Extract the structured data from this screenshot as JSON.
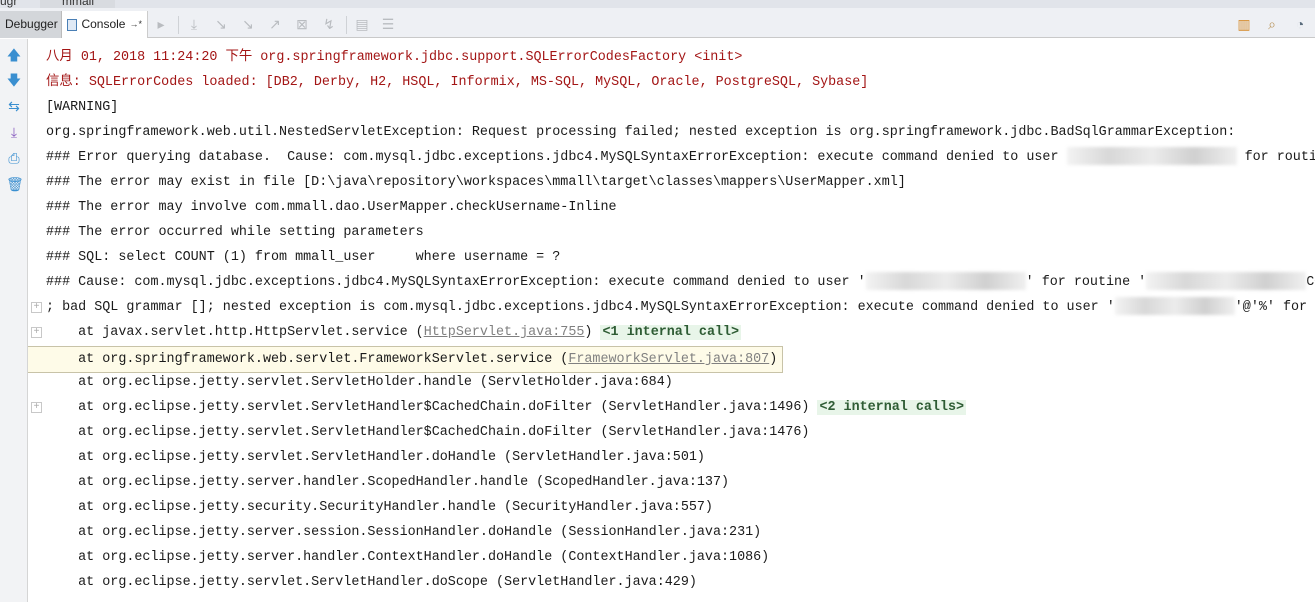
{
  "top_tabs": [
    "ugr",
    "mmall"
  ],
  "toolbar": {
    "debugger_tab": "Debugger",
    "console_tab": "Console",
    "console_suffix": "→*"
  },
  "console": {
    "lines": [
      {
        "cls": "red",
        "segs": [
          {
            "t": "八月 01, 2018 11:24:20 下午 org.springframework.jdbc.support.SQLErrorCodesFactory <init>"
          }
        ]
      },
      {
        "cls": "red",
        "segs": [
          {
            "t": "信息: SQLErrorCodes loaded: [DB2, Derby, H2, HSQL, Informix, MS-SQL, MySQL, Oracle, PostgreSQL, Sybase]"
          }
        ]
      },
      {
        "segs": [
          {
            "t": "[WARNING]"
          }
        ]
      },
      {
        "segs": [
          {
            "t": "org.springframework.web.util.NestedServletException: Request processing failed; nested exception is org.springframework.jdbc.BadSqlGrammarException:"
          }
        ]
      },
      {
        "segs": [
          {
            "t": "### Error querying database.  Cause: com.mysql.jdbc.exceptions.jdbc4.MySQLSyntaxErrorException: execute command denied to user "
          },
          {
            "blur": 170
          },
          {
            "t": " for routine"
          }
        ]
      },
      {
        "segs": [
          {
            "t": "### The error may exist in file [D:\\java\\repository\\workspaces\\mmall\\target\\classes\\mappers\\UserMapper.xml]"
          }
        ]
      },
      {
        "segs": [
          {
            "t": "### The error may involve com.mmall.dao.UserMapper.checkUsername-Inline"
          }
        ]
      },
      {
        "segs": [
          {
            "t": "### The error occurred while setting parameters"
          }
        ]
      },
      {
        "segs": [
          {
            "t": "### SQL: select COUNT (1) from mmall_user     where username = ?"
          }
        ]
      },
      {
        "segs": [
          {
            "t": "### Cause: com.mysql.jdbc.exceptions.jdbc4.MySQLSyntaxErrorException: execute command denied to user '"
          },
          {
            "blur": 160
          },
          {
            "t": "' for routine '"
          },
          {
            "blur": 160
          },
          {
            "t": "COUNT"
          }
        ]
      },
      {
        "fold": true,
        "segs": [
          {
            "t": "; bad SQL grammar []; nested exception is com.mysql.jdbc.exceptions.jdbc4.MySQLSyntaxErrorException: execute command denied to user '"
          },
          {
            "blur": 120
          },
          {
            "t": "'@'%' for r"
          }
        ]
      },
      {
        "fold": true,
        "segs": [
          {
            "t": "    at javax.servlet.http.HttpServlet.service ("
          },
          {
            "link": "HttpServlet.java:755"
          },
          {
            "t": ") "
          },
          {
            "internal": "<1 internal call>"
          }
        ]
      },
      {
        "segs": [
          {
            "t": "    at org.springframework.web.servlet.FrameworkServlet.service ("
          },
          {
            "link": "FrameworkServlet.java:807"
          },
          {
            "t": ")"
          }
        ]
      },
      {
        "segs": [
          {
            "t": "    at org.eclipse.jetty.servlet.ServletHolder.handle (ServletHolder.java:684)"
          }
        ]
      },
      {
        "fold": true,
        "segs": [
          {
            "t": "    at org.eclipse.jetty.servlet.ServletHandler$CachedChain.doFilter (ServletHandler.java:1496) "
          },
          {
            "internal": "<2 internal calls>"
          }
        ]
      },
      {
        "segs": [
          {
            "t": "    at org.eclipse.jetty.servlet.ServletHandler$CachedChain.doFilter (ServletHandler.java:1476)"
          }
        ]
      },
      {
        "segs": [
          {
            "t": "    at org.eclipse.jetty.servlet.ServletHandler.doHandle (ServletHandler.java:501)"
          }
        ]
      },
      {
        "segs": [
          {
            "t": "    at org.eclipse.jetty.server.handler.ScopedHandler.handle (ScopedHandler.java:137)"
          }
        ]
      },
      {
        "segs": [
          {
            "t": "    at org.eclipse.jetty.security.SecurityHandler.handle (SecurityHandler.java:557)"
          }
        ]
      },
      {
        "segs": [
          {
            "t": "    at org.eclipse.jetty.server.session.SessionHandler.doHandle (SessionHandler.java:231)"
          }
        ]
      },
      {
        "segs": [
          {
            "t": "    at org.eclipse.jetty.server.handler.ContextHandler.doHandle (ContextHandler.java:1086)"
          }
        ]
      },
      {
        "segs": [
          {
            "t": "    at org.eclipse.jetty.servlet.ServletHandler.doScope (ServletHandler.java:429)"
          }
        ]
      }
    ]
  }
}
